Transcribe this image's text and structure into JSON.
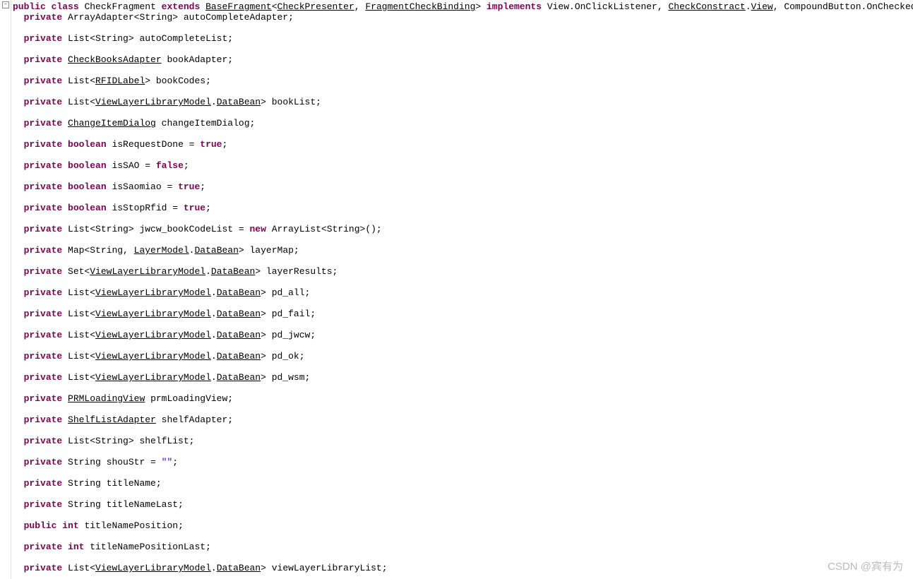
{
  "watermark": "CSDN @宾有为",
  "fold_symbol": "−",
  "lines": [
    {
      "indent": 0,
      "tokens": [
        {
          "t": "kw",
          "v": "public"
        },
        {
          "t": "sp",
          "v": " "
        },
        {
          "t": "kw",
          "v": "class"
        },
        {
          "t": "sp",
          "v": " "
        },
        {
          "t": "ident",
          "v": "CheckFragment "
        },
        {
          "t": "kw",
          "v": "extends"
        },
        {
          "t": "sp",
          "v": " "
        },
        {
          "t": "link",
          "v": "BaseFragment"
        },
        {
          "t": "op",
          "v": "<"
        },
        {
          "t": "link",
          "v": "CheckPresenter"
        },
        {
          "t": "op",
          "v": ", "
        },
        {
          "t": "link",
          "v": "FragmentCheckBinding"
        },
        {
          "t": "op",
          "v": "> "
        },
        {
          "t": "kw",
          "v": "implements"
        },
        {
          "t": "sp",
          "v": " "
        },
        {
          "t": "ident",
          "v": "View.OnClickListener, "
        },
        {
          "t": "link",
          "v": "CheckConstract"
        },
        {
          "t": "op",
          "v": "."
        },
        {
          "t": "link",
          "v": "View"
        },
        {
          "t": "op",
          "v": ", CompoundButton.OnCheckedChangeListener {"
        }
      ]
    },
    {
      "indent": 1,
      "tokens": [
        {
          "t": "kw",
          "v": "private"
        },
        {
          "t": "sp",
          "v": " "
        },
        {
          "t": "ident",
          "v": "ArrayAdapter<String> autoCompleteAdapter;"
        }
      ]
    },
    {
      "blank": true
    },
    {
      "indent": 1,
      "tokens": [
        {
          "t": "kw",
          "v": "private"
        },
        {
          "t": "sp",
          "v": " "
        },
        {
          "t": "ident",
          "v": "List<String> autoCompleteList;"
        }
      ]
    },
    {
      "blank": true
    },
    {
      "indent": 1,
      "tokens": [
        {
          "t": "kw",
          "v": "private"
        },
        {
          "t": "sp",
          "v": " "
        },
        {
          "t": "link",
          "v": "CheckBooksAdapter"
        },
        {
          "t": "sp",
          "v": " "
        },
        {
          "t": "ident",
          "v": "bookAdapter;"
        }
      ]
    },
    {
      "blank": true
    },
    {
      "indent": 1,
      "tokens": [
        {
          "t": "kw",
          "v": "private"
        },
        {
          "t": "sp",
          "v": " "
        },
        {
          "t": "ident",
          "v": "List<"
        },
        {
          "t": "link",
          "v": "RFIDLabel"
        },
        {
          "t": "ident",
          "v": "> bookCodes;"
        }
      ]
    },
    {
      "blank": true
    },
    {
      "indent": 1,
      "tokens": [
        {
          "t": "kw",
          "v": "private"
        },
        {
          "t": "sp",
          "v": " "
        },
        {
          "t": "ident",
          "v": "List<"
        },
        {
          "t": "link",
          "v": "ViewLayerLibraryModel"
        },
        {
          "t": "op",
          "v": "."
        },
        {
          "t": "link",
          "v": "DataBean"
        },
        {
          "t": "ident",
          "v": "> bookList;"
        }
      ]
    },
    {
      "blank": true
    },
    {
      "indent": 1,
      "tokens": [
        {
          "t": "kw",
          "v": "private"
        },
        {
          "t": "sp",
          "v": " "
        },
        {
          "t": "link",
          "v": "ChangeItemDialog"
        },
        {
          "t": "sp",
          "v": " "
        },
        {
          "t": "ident",
          "v": "changeItemDialog;"
        }
      ]
    },
    {
      "blank": true
    },
    {
      "indent": 1,
      "tokens": [
        {
          "t": "kw",
          "v": "private"
        },
        {
          "t": "sp",
          "v": " "
        },
        {
          "t": "kw",
          "v": "boolean"
        },
        {
          "t": "sp",
          "v": " "
        },
        {
          "t": "ident",
          "v": "isRequestDone = "
        },
        {
          "t": "kw",
          "v": "true"
        },
        {
          "t": "op",
          "v": ";"
        }
      ]
    },
    {
      "blank": true
    },
    {
      "indent": 1,
      "tokens": [
        {
          "t": "kw",
          "v": "private"
        },
        {
          "t": "sp",
          "v": " "
        },
        {
          "t": "kw",
          "v": "boolean"
        },
        {
          "t": "sp",
          "v": " "
        },
        {
          "t": "ident",
          "v": "isSAO = "
        },
        {
          "t": "kw",
          "v": "false"
        },
        {
          "t": "op",
          "v": ";"
        }
      ]
    },
    {
      "blank": true
    },
    {
      "indent": 1,
      "tokens": [
        {
          "t": "kw",
          "v": "private"
        },
        {
          "t": "sp",
          "v": " "
        },
        {
          "t": "kw",
          "v": "boolean"
        },
        {
          "t": "sp",
          "v": " "
        },
        {
          "t": "ident",
          "v": "isSaomiao = "
        },
        {
          "t": "kw",
          "v": "true"
        },
        {
          "t": "op",
          "v": ";"
        }
      ]
    },
    {
      "blank": true
    },
    {
      "indent": 1,
      "tokens": [
        {
          "t": "kw",
          "v": "private"
        },
        {
          "t": "sp",
          "v": " "
        },
        {
          "t": "kw",
          "v": "boolean"
        },
        {
          "t": "sp",
          "v": " "
        },
        {
          "t": "ident",
          "v": "isStopRfid = "
        },
        {
          "t": "kw",
          "v": "true"
        },
        {
          "t": "op",
          "v": ";"
        }
      ]
    },
    {
      "blank": true
    },
    {
      "indent": 1,
      "tokens": [
        {
          "t": "kw",
          "v": "private"
        },
        {
          "t": "sp",
          "v": " "
        },
        {
          "t": "ident",
          "v": "List<String> jwcw_bookCodeList = "
        },
        {
          "t": "kw",
          "v": "new"
        },
        {
          "t": "sp",
          "v": " "
        },
        {
          "t": "ident",
          "v": "ArrayList<String>();"
        }
      ]
    },
    {
      "blank": true
    },
    {
      "indent": 1,
      "tokens": [
        {
          "t": "kw",
          "v": "private"
        },
        {
          "t": "sp",
          "v": " "
        },
        {
          "t": "ident",
          "v": "Map<String, "
        },
        {
          "t": "link",
          "v": "LayerModel"
        },
        {
          "t": "op",
          "v": "."
        },
        {
          "t": "link",
          "v": "DataBean"
        },
        {
          "t": "ident",
          "v": "> layerMap;"
        }
      ]
    },
    {
      "blank": true
    },
    {
      "indent": 1,
      "tokens": [
        {
          "t": "kw",
          "v": "private"
        },
        {
          "t": "sp",
          "v": " "
        },
        {
          "t": "ident",
          "v": "Set<"
        },
        {
          "t": "link",
          "v": "ViewLayerLibraryModel"
        },
        {
          "t": "op",
          "v": "."
        },
        {
          "t": "link",
          "v": "DataBean"
        },
        {
          "t": "ident",
          "v": "> layerResults;"
        }
      ]
    },
    {
      "blank": true
    },
    {
      "indent": 1,
      "tokens": [
        {
          "t": "kw",
          "v": "private"
        },
        {
          "t": "sp",
          "v": " "
        },
        {
          "t": "ident",
          "v": "List<"
        },
        {
          "t": "link",
          "v": "ViewLayerLibraryModel"
        },
        {
          "t": "op",
          "v": "."
        },
        {
          "t": "link",
          "v": "DataBean"
        },
        {
          "t": "ident",
          "v": "> pd_all;"
        }
      ]
    },
    {
      "blank": true
    },
    {
      "indent": 1,
      "tokens": [
        {
          "t": "kw",
          "v": "private"
        },
        {
          "t": "sp",
          "v": " "
        },
        {
          "t": "ident",
          "v": "List<"
        },
        {
          "t": "link",
          "v": "ViewLayerLibraryModel"
        },
        {
          "t": "op",
          "v": "."
        },
        {
          "t": "link",
          "v": "DataBean"
        },
        {
          "t": "ident",
          "v": "> pd_fail;"
        }
      ]
    },
    {
      "blank": true
    },
    {
      "indent": 1,
      "tokens": [
        {
          "t": "kw",
          "v": "private"
        },
        {
          "t": "sp",
          "v": " "
        },
        {
          "t": "ident",
          "v": "List<"
        },
        {
          "t": "link",
          "v": "ViewLayerLibraryModel"
        },
        {
          "t": "op",
          "v": "."
        },
        {
          "t": "link",
          "v": "DataBean"
        },
        {
          "t": "ident",
          "v": "> pd_jwcw;"
        }
      ]
    },
    {
      "blank": true
    },
    {
      "indent": 1,
      "tokens": [
        {
          "t": "kw",
          "v": "private"
        },
        {
          "t": "sp",
          "v": " "
        },
        {
          "t": "ident",
          "v": "List<"
        },
        {
          "t": "link",
          "v": "ViewLayerLibraryModel"
        },
        {
          "t": "op",
          "v": "."
        },
        {
          "t": "link",
          "v": "DataBean"
        },
        {
          "t": "ident",
          "v": "> pd_ok;"
        }
      ]
    },
    {
      "blank": true
    },
    {
      "indent": 1,
      "tokens": [
        {
          "t": "kw",
          "v": "private"
        },
        {
          "t": "sp",
          "v": " "
        },
        {
          "t": "ident",
          "v": "List<"
        },
        {
          "t": "link",
          "v": "ViewLayerLibraryModel"
        },
        {
          "t": "op",
          "v": "."
        },
        {
          "t": "link",
          "v": "DataBean"
        },
        {
          "t": "ident",
          "v": "> pd_wsm;"
        }
      ]
    },
    {
      "blank": true
    },
    {
      "indent": 1,
      "tokens": [
        {
          "t": "kw",
          "v": "private"
        },
        {
          "t": "sp",
          "v": " "
        },
        {
          "t": "link",
          "v": "PRMLoadingView"
        },
        {
          "t": "sp",
          "v": " "
        },
        {
          "t": "ident",
          "v": "prmLoadingView;"
        }
      ]
    },
    {
      "blank": true
    },
    {
      "indent": 1,
      "tokens": [
        {
          "t": "kw",
          "v": "private"
        },
        {
          "t": "sp",
          "v": " "
        },
        {
          "t": "link",
          "v": "ShelfListAdapter"
        },
        {
          "t": "sp",
          "v": " "
        },
        {
          "t": "ident",
          "v": "shelfAdapter;"
        }
      ]
    },
    {
      "blank": true
    },
    {
      "indent": 1,
      "tokens": [
        {
          "t": "kw",
          "v": "private"
        },
        {
          "t": "sp",
          "v": " "
        },
        {
          "t": "ident",
          "v": "List<String> shelfList;"
        }
      ]
    },
    {
      "blank": true
    },
    {
      "indent": 1,
      "tokens": [
        {
          "t": "kw",
          "v": "private"
        },
        {
          "t": "sp",
          "v": " "
        },
        {
          "t": "ident",
          "v": "String shouStr = "
        },
        {
          "t": "str",
          "v": "\"\""
        },
        {
          "t": "op",
          "v": ";"
        }
      ]
    },
    {
      "blank": true
    },
    {
      "indent": 1,
      "tokens": [
        {
          "t": "kw",
          "v": "private"
        },
        {
          "t": "sp",
          "v": " "
        },
        {
          "t": "ident",
          "v": "String titleName;"
        }
      ]
    },
    {
      "blank": true
    },
    {
      "indent": 1,
      "tokens": [
        {
          "t": "kw",
          "v": "private"
        },
        {
          "t": "sp",
          "v": " "
        },
        {
          "t": "ident",
          "v": "String titleNameLast;"
        }
      ]
    },
    {
      "blank": true
    },
    {
      "indent": 1,
      "tokens": [
        {
          "t": "kw",
          "v": "public"
        },
        {
          "t": "sp",
          "v": " "
        },
        {
          "t": "kw",
          "v": "int"
        },
        {
          "t": "sp",
          "v": " "
        },
        {
          "t": "ident",
          "v": "titleNamePosition;"
        }
      ]
    },
    {
      "blank": true
    },
    {
      "indent": 1,
      "tokens": [
        {
          "t": "kw",
          "v": "private"
        },
        {
          "t": "sp",
          "v": " "
        },
        {
          "t": "kw",
          "v": "int"
        },
        {
          "t": "sp",
          "v": " "
        },
        {
          "t": "ident",
          "v": "titleNamePositionLast;"
        }
      ]
    },
    {
      "blank": true
    },
    {
      "indent": 1,
      "tokens": [
        {
          "t": "kw",
          "v": "private"
        },
        {
          "t": "sp",
          "v": " "
        },
        {
          "t": "ident",
          "v": "List<"
        },
        {
          "t": "link",
          "v": "ViewLayerLibraryModel"
        },
        {
          "t": "op",
          "v": "."
        },
        {
          "t": "link",
          "v": "DataBean"
        },
        {
          "t": "ident",
          "v": "> viewLayerLibraryList;"
        }
      ]
    }
  ]
}
